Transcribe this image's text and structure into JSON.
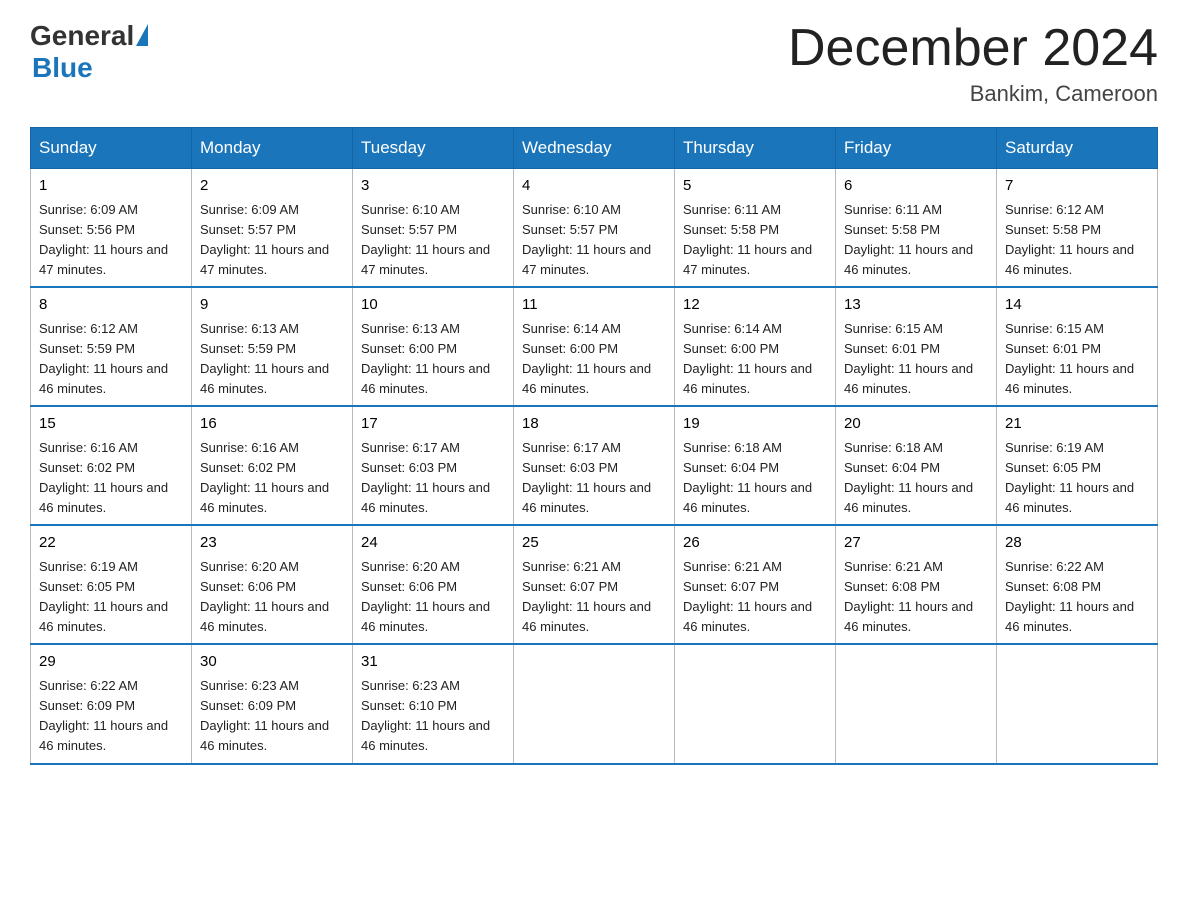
{
  "logo": {
    "general": "General",
    "blue": "Blue"
  },
  "title": "December 2024",
  "location": "Bankim, Cameroon",
  "days_of_week": [
    "Sunday",
    "Monday",
    "Tuesday",
    "Wednesday",
    "Thursday",
    "Friday",
    "Saturday"
  ],
  "weeks": [
    [
      {
        "day": "1",
        "sunrise": "6:09 AM",
        "sunset": "5:56 PM",
        "daylight": "11 hours and 47 minutes."
      },
      {
        "day": "2",
        "sunrise": "6:09 AM",
        "sunset": "5:57 PM",
        "daylight": "11 hours and 47 minutes."
      },
      {
        "day": "3",
        "sunrise": "6:10 AM",
        "sunset": "5:57 PM",
        "daylight": "11 hours and 47 minutes."
      },
      {
        "day": "4",
        "sunrise": "6:10 AM",
        "sunset": "5:57 PM",
        "daylight": "11 hours and 47 minutes."
      },
      {
        "day": "5",
        "sunrise": "6:11 AM",
        "sunset": "5:58 PM",
        "daylight": "11 hours and 47 minutes."
      },
      {
        "day": "6",
        "sunrise": "6:11 AM",
        "sunset": "5:58 PM",
        "daylight": "11 hours and 46 minutes."
      },
      {
        "day": "7",
        "sunrise": "6:12 AM",
        "sunset": "5:58 PM",
        "daylight": "11 hours and 46 minutes."
      }
    ],
    [
      {
        "day": "8",
        "sunrise": "6:12 AM",
        "sunset": "5:59 PM",
        "daylight": "11 hours and 46 minutes."
      },
      {
        "day": "9",
        "sunrise": "6:13 AM",
        "sunset": "5:59 PM",
        "daylight": "11 hours and 46 minutes."
      },
      {
        "day": "10",
        "sunrise": "6:13 AM",
        "sunset": "6:00 PM",
        "daylight": "11 hours and 46 minutes."
      },
      {
        "day": "11",
        "sunrise": "6:14 AM",
        "sunset": "6:00 PM",
        "daylight": "11 hours and 46 minutes."
      },
      {
        "day": "12",
        "sunrise": "6:14 AM",
        "sunset": "6:00 PM",
        "daylight": "11 hours and 46 minutes."
      },
      {
        "day": "13",
        "sunrise": "6:15 AM",
        "sunset": "6:01 PM",
        "daylight": "11 hours and 46 minutes."
      },
      {
        "day": "14",
        "sunrise": "6:15 AM",
        "sunset": "6:01 PM",
        "daylight": "11 hours and 46 minutes."
      }
    ],
    [
      {
        "day": "15",
        "sunrise": "6:16 AM",
        "sunset": "6:02 PM",
        "daylight": "11 hours and 46 minutes."
      },
      {
        "day": "16",
        "sunrise": "6:16 AM",
        "sunset": "6:02 PM",
        "daylight": "11 hours and 46 minutes."
      },
      {
        "day": "17",
        "sunrise": "6:17 AM",
        "sunset": "6:03 PM",
        "daylight": "11 hours and 46 minutes."
      },
      {
        "day": "18",
        "sunrise": "6:17 AM",
        "sunset": "6:03 PM",
        "daylight": "11 hours and 46 minutes."
      },
      {
        "day": "19",
        "sunrise": "6:18 AM",
        "sunset": "6:04 PM",
        "daylight": "11 hours and 46 minutes."
      },
      {
        "day": "20",
        "sunrise": "6:18 AM",
        "sunset": "6:04 PM",
        "daylight": "11 hours and 46 minutes."
      },
      {
        "day": "21",
        "sunrise": "6:19 AM",
        "sunset": "6:05 PM",
        "daylight": "11 hours and 46 minutes."
      }
    ],
    [
      {
        "day": "22",
        "sunrise": "6:19 AM",
        "sunset": "6:05 PM",
        "daylight": "11 hours and 46 minutes."
      },
      {
        "day": "23",
        "sunrise": "6:20 AM",
        "sunset": "6:06 PM",
        "daylight": "11 hours and 46 minutes."
      },
      {
        "day": "24",
        "sunrise": "6:20 AM",
        "sunset": "6:06 PM",
        "daylight": "11 hours and 46 minutes."
      },
      {
        "day": "25",
        "sunrise": "6:21 AM",
        "sunset": "6:07 PM",
        "daylight": "11 hours and 46 minutes."
      },
      {
        "day": "26",
        "sunrise": "6:21 AM",
        "sunset": "6:07 PM",
        "daylight": "11 hours and 46 minutes."
      },
      {
        "day": "27",
        "sunrise": "6:21 AM",
        "sunset": "6:08 PM",
        "daylight": "11 hours and 46 minutes."
      },
      {
        "day": "28",
        "sunrise": "6:22 AM",
        "sunset": "6:08 PM",
        "daylight": "11 hours and 46 minutes."
      }
    ],
    [
      {
        "day": "29",
        "sunrise": "6:22 AM",
        "sunset": "6:09 PM",
        "daylight": "11 hours and 46 minutes."
      },
      {
        "day": "30",
        "sunrise": "6:23 AM",
        "sunset": "6:09 PM",
        "daylight": "11 hours and 46 minutes."
      },
      {
        "day": "31",
        "sunrise": "6:23 AM",
        "sunset": "6:10 PM",
        "daylight": "11 hours and 46 minutes."
      },
      null,
      null,
      null,
      null
    ]
  ],
  "labels": {
    "sunrise": "Sunrise: ",
    "sunset": "Sunset: ",
    "daylight": "Daylight: "
  }
}
